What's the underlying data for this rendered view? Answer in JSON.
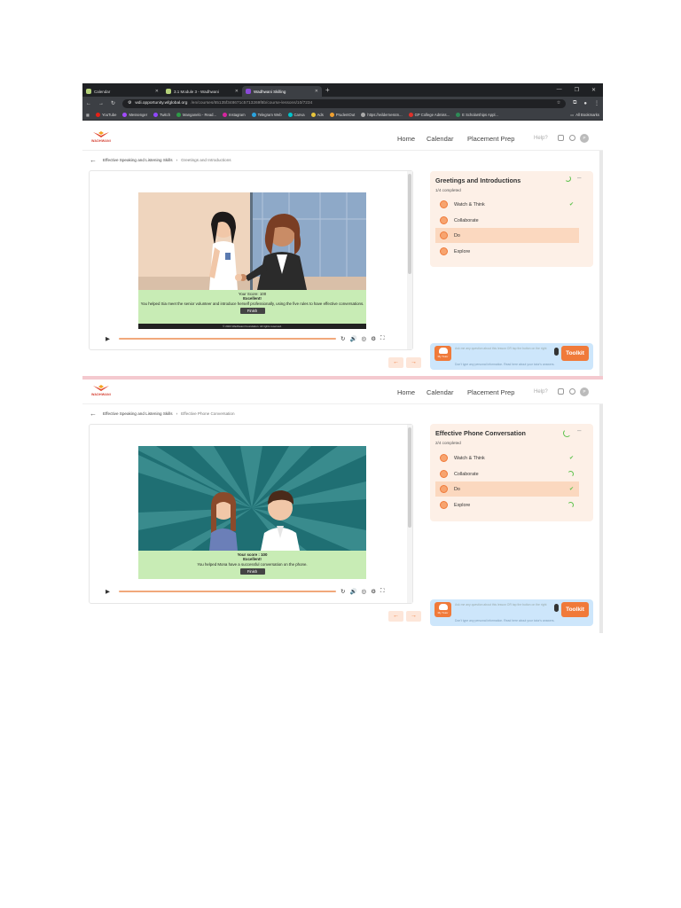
{
  "browser": {
    "tabs": [
      {
        "label": "Calendar",
        "active": false
      },
      {
        "label": "3.1 Module 3 - Wadhwani",
        "active": false
      },
      {
        "label": "Wadhwani Skilling",
        "active": true
      }
    ],
    "url_host": "wdi.opportunity.wfglobal.org",
    "url_path": "/en/courses/65135f348671c5713269f8b/course-lessons/10/7234",
    "bookmarks": [
      "YouTube",
      "Messenger",
      "Twitch",
      "Manganelo - Read...",
      "Instagram",
      "Telegram Web",
      "Canva",
      "Ads",
      "PrudentOut",
      "https://wildernessm...",
      "GP College Admiss...",
      "E Scholarships Appl...",
      "All Bookmarks"
    ]
  },
  "app": {
    "logo_text": "WADHWANI",
    "nav": [
      "Home",
      "Calendar",
      "Placement Prep"
    ],
    "help": "Help?",
    "avatar": "P"
  },
  "lessons": [
    {
      "breadcrumb_parent": "Effective Speaking and Listening Skills",
      "breadcrumb_current": "Greetings and Introductions",
      "result_score": "Your Score: 100",
      "result_title": "Excellent!",
      "result_text": "You helped Sia meet the senior volunteer and introduce herself professionally, using the five rules to have effective conversations.",
      "finish_label": "Finish",
      "copyright": "© 2023 Wadhwani Foundation. All rights reserved.",
      "panel_title": "Greetings and Introductions",
      "completed": "1/4 completed",
      "steps": [
        {
          "label": "Watch & Think",
          "status": "done"
        },
        {
          "label": "Collaborate",
          "status": "none"
        },
        {
          "label": "Do",
          "status": "active"
        },
        {
          "label": "Explore",
          "status": "none"
        }
      ],
      "tutor_placeholder": "Ask me any question about this lesson OR tap the button on the right",
      "tutor_label": "My Tutor",
      "toolkit_label": "Toolkit",
      "tutor_warning": "Don't type any personal information. Read here about your tutor's answers."
    },
    {
      "breadcrumb_parent": "Effective Speaking and Listening Skills",
      "breadcrumb_current": "Effective Phone Conversation",
      "result_score": "Your score : 100",
      "result_title": "Excellent!",
      "result_text": "You helped Mona have a successful conversation on the phone.",
      "finish_label": "Finish",
      "copyright": "",
      "panel_title": "Effective Phone Conversation",
      "completed": "2/4 completed",
      "steps": [
        {
          "label": "Watch & Think",
          "status": "done"
        },
        {
          "label": "Collaborate",
          "status": "progress"
        },
        {
          "label": "Do",
          "status": "active-done"
        },
        {
          "label": "Explore",
          "status": "progress"
        }
      ],
      "tutor_placeholder": "Ask me any question about this lesson OR tap the button on the right",
      "tutor_label": "My Tutor",
      "toolkit_label": "Toolkit",
      "tutor_warning": "Don't type any personal information. Read here about your tutor's answers."
    }
  ],
  "colors": {
    "accent": "#f07a3a",
    "panel_bg": "#fdf0e7",
    "active_step": "#fbd8bf",
    "result_bg": "#c8ecb5",
    "success": "#5ec24c",
    "tutor_bg": "#cde6fb"
  }
}
